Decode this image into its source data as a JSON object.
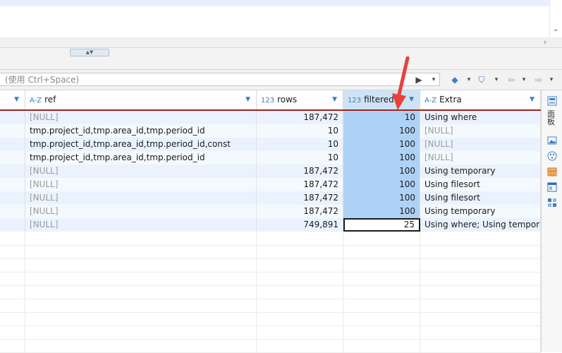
{
  "filter_bar": {
    "placeholder": "(使用 Ctrl+Space)",
    "buttons": [
      "▶",
      "▾",
      "◆",
      "▾",
      "⛉",
      "▾",
      "⇦",
      "▾",
      "⇨",
      "▾"
    ]
  },
  "grid": {
    "columns": [
      {
        "key": "prev",
        "type_icon": "",
        "label": ""
      },
      {
        "key": "ref",
        "type_icon": "A-Z",
        "label": "ref"
      },
      {
        "key": "rows",
        "type_icon": "123",
        "label": "rows"
      },
      {
        "key": "filtered",
        "type_icon": "123",
        "label": "filtered"
      },
      {
        "key": "extra",
        "type_icon": "A-Z",
        "label": "Extra"
      }
    ],
    "rows": [
      {
        "ref": "[NULL]",
        "rows": "187,472",
        "filtered": "10",
        "extra": "Using where"
      },
      {
        "ref": "tmp.project_id,tmp.area_id,tmp.period_id",
        "rows": "10",
        "filtered": "100",
        "extra": "[NULL]"
      },
      {
        "ref": "tmp.project_id,tmp.area_id,tmp.period_id,const",
        "rows": "10",
        "filtered": "100",
        "extra": "[NULL]"
      },
      {
        "ref": "tmp.project_id,tmp.area_id,tmp.period_id",
        "rows": "10",
        "filtered": "100",
        "extra": "[NULL]"
      },
      {
        "ref": "[NULL]",
        "rows": "187,472",
        "filtered": "100",
        "extra": "Using temporary"
      },
      {
        "ref": "[NULL]",
        "rows": "187,472",
        "filtered": "100",
        "extra": "Using filesort"
      },
      {
        "ref": "[NULL]",
        "rows": "187,472",
        "filtered": "100",
        "extra": "Using filesort"
      },
      {
        "ref": "[NULL]",
        "rows": "187,472",
        "filtered": "100",
        "extra": "Using temporary"
      },
      {
        "ref": "[NULL]",
        "rows": "749,891",
        "filtered": "25",
        "extra": "Using where; Using temporary"
      }
    ],
    "selected_cell": {
      "row": 8,
      "column": "filtered"
    }
  },
  "side_panel": {
    "label": "面板",
    "icons": [
      "panel-icon",
      "image-icon",
      "palette-icon",
      "calendar-icon",
      "window-icon",
      "grid-icon"
    ]
  },
  "colors": {
    "header_active": "#cfe3f7",
    "filtered_column": "#aed2f5",
    "row_odd": "#eaf3fd",
    "row_even": "#f4f9fe",
    "annotation": "#e8403c",
    "header_underline": "#9b2525"
  }
}
